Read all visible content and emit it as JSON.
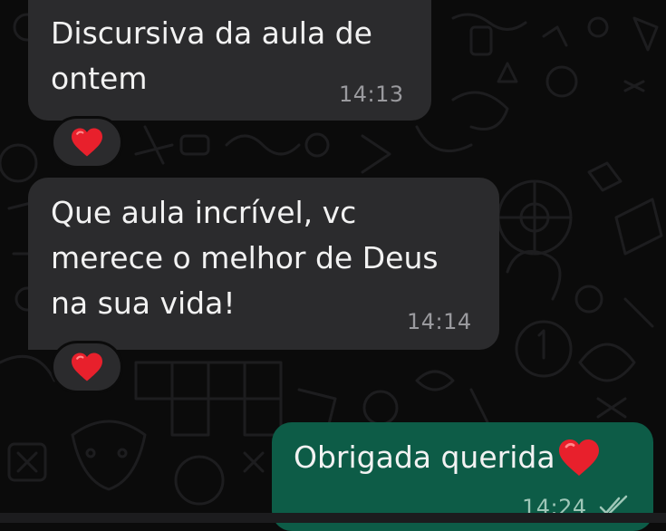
{
  "messages": [
    {
      "direction": "incoming",
      "text": "Discursiva da aula de ontem",
      "time": "14:13",
      "reaction": "heart-emoji"
    },
    {
      "direction": "incoming",
      "text": "Que aula incrível, vc merece o melhor de Deus na sua vida!",
      "time": "14:14",
      "reaction": "heart-emoji"
    },
    {
      "direction": "outgoing",
      "text": "Obrigada querida",
      "time": "14:24",
      "status": "double-check-icon",
      "trailing_icon": "heart-emoji"
    }
  ],
  "colors": {
    "background": "#0b0b0b",
    "incoming_bubble": "#2b2b2d",
    "outgoing_bubble": "#0d5c47",
    "heart": "#e8202c",
    "timestamp": "#9a9a9e"
  }
}
